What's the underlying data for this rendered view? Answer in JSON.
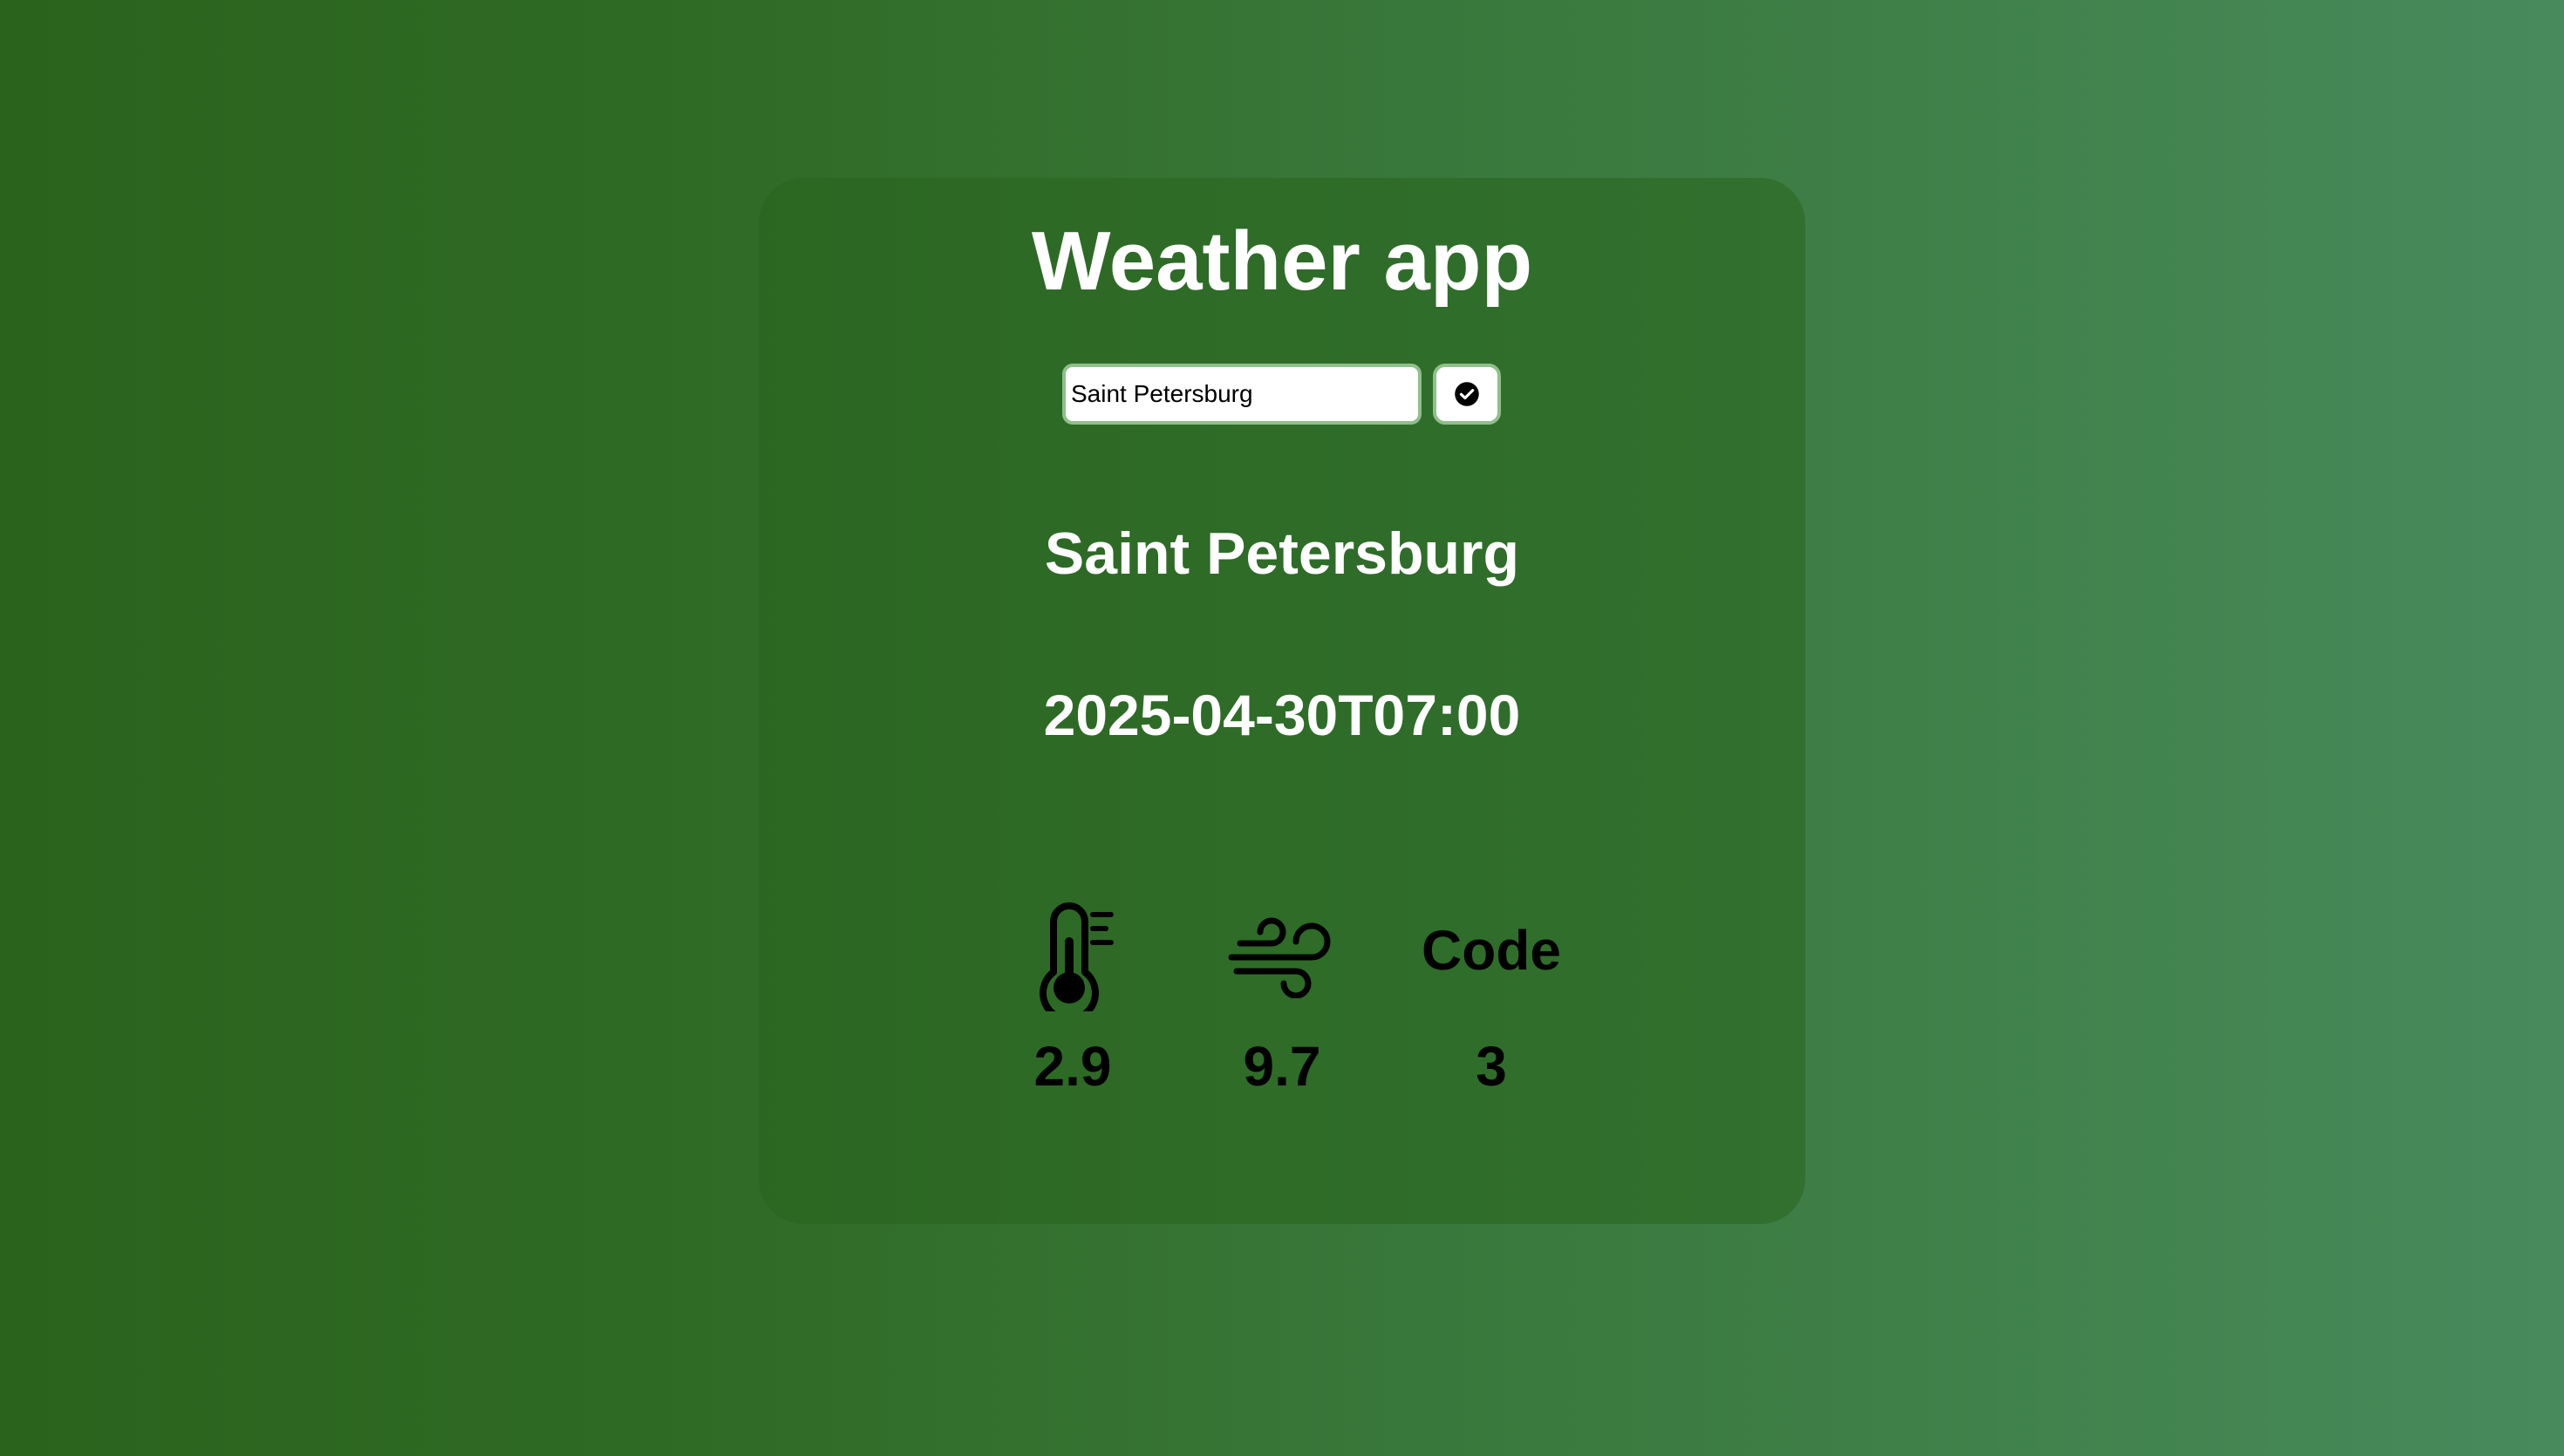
{
  "app": {
    "title": "Weather app"
  },
  "search": {
    "value": "Saint Petersburg",
    "submit_icon": "check-circle-icon"
  },
  "location": {
    "city": "Saint Petersburg",
    "datetime": "2025-04-30T07:00"
  },
  "metrics": {
    "temperature": {
      "icon": "thermometer-icon",
      "value": "2.9"
    },
    "wind": {
      "icon": "wind-icon",
      "value": "9.7"
    },
    "code": {
      "label": "Code",
      "value": "3"
    }
  },
  "colors": {
    "background_start": "#2a631c",
    "background_end": "#488a5c",
    "card": "#2e6a22",
    "text_light": "#ffffff",
    "text_dark": "#000000"
  }
}
